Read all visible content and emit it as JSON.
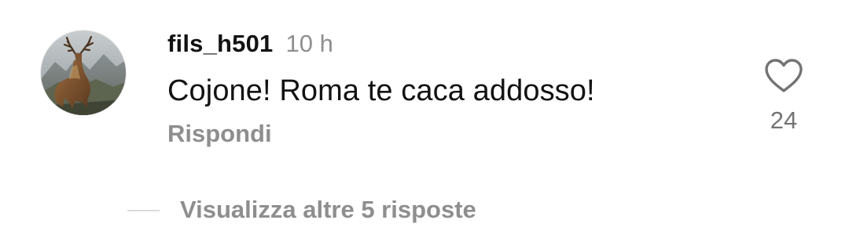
{
  "comment": {
    "avatar_icon": "deer-avatar-icon",
    "username": "fils_h501",
    "timestamp": "10 h",
    "text": "Cojone! Roma te caca addosso!",
    "reply_label": "Rispondi",
    "like_icon": "heart-outline-icon",
    "like_count": "24"
  },
  "replies": {
    "view_more_label": "Visualizza altre 5 risposte"
  },
  "colors": {
    "primary_text": "#121212",
    "secondary_text": "#8e8e8e",
    "divider": "#dbdbdb"
  }
}
